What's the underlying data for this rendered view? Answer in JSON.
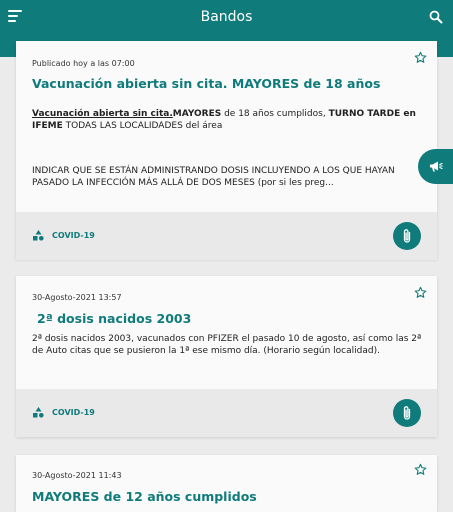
{
  "app": {
    "title": "Bandos"
  },
  "cards": [
    {
      "date": "Publicado hoy a las 07:00",
      "title": "Vacunación abierta sin cita. MAYORES de 18 años",
      "body": {
        "p1_u": "Vacunación abierta sin cita.",
        "p1_b1": "MAYORES",
        "p1_t1": " de 18 años cumplidos, ",
        "p1_b2": "TURNO TARDE en IFEME",
        "p1_t2": " TODAS LAS LOCALIDADES del área",
        "p2": "INDICAR QUE SE ESTÁN ADMINISTRANDO DOSIS INCLUYENDO A LOS QUE HAYAN PASADO LA INFECCIÓN MÁS ALLÁ DE DOS MESES (por si les preg..."
      },
      "category": "COVID-19"
    },
    {
      "date": "30-Agosto-2021 13:57",
      "title": "2ª dosis nacidos 2003",
      "body": {
        "p1": "2ª dosis nacidos 2003, vacunados con PFIZER el pasado 10 de agosto, así como las 2ª de Auto citas que se pusieron la 1ª ese mismo día. (Horario según localidad)."
      },
      "category": "COVID-19"
    },
    {
      "date": "30-Agosto-2021 11:43",
      "title": "MAYORES de 12 años cumplidos"
    }
  ],
  "colors": {
    "primary": "#0f7b7b",
    "background": "#ebebeb",
    "card": "#fafafa",
    "footer": "#e9e9e9"
  },
  "icons": [
    "menu-icon",
    "search-icon",
    "star-icon",
    "category-shapes-icon",
    "paperclip-icon",
    "megaphone-icon"
  ]
}
